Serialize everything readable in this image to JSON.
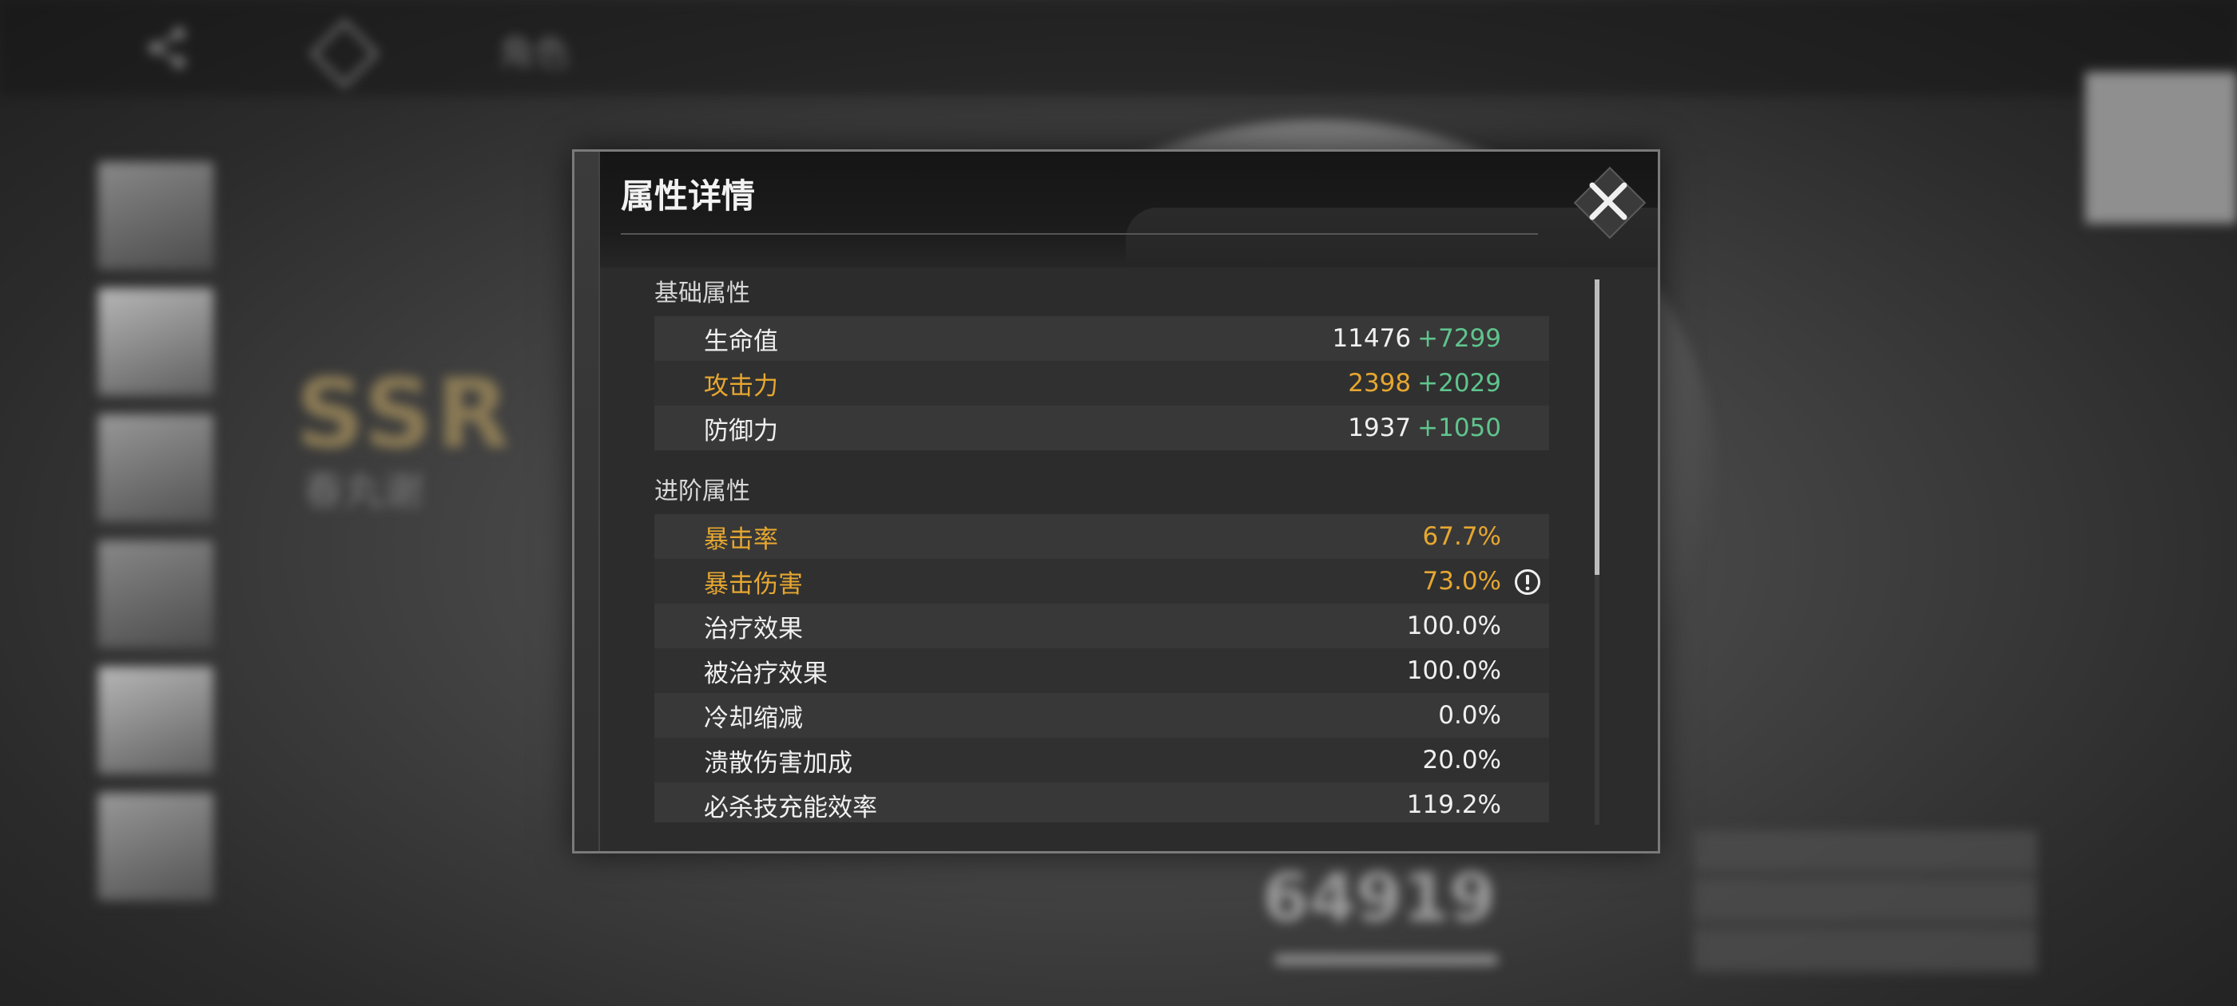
{
  "background": {
    "nav_title": "角色",
    "rarity": "SSR",
    "character_name": "春丸谢",
    "power_value": "64919",
    "share_icon": "share-icon",
    "diamond_icon": "diamond-icon"
  },
  "dialog": {
    "title": "属性详情",
    "close_icon": "close-icon",
    "sections": [
      {
        "label": "基础属性",
        "rows": [
          {
            "name": "生命值",
            "base": "11476",
            "bonus": "+7299",
            "highlight": false
          },
          {
            "name": "攻击力",
            "base": "2398",
            "bonus": "+2029",
            "highlight": true
          },
          {
            "name": "防御力",
            "base": "1937",
            "bonus": "+1050",
            "highlight": false
          }
        ]
      },
      {
        "label": "进阶属性",
        "rows": [
          {
            "name": "暴击率",
            "base": "67.7%",
            "highlight": true
          },
          {
            "name": "暴击伤害",
            "base": "73.0%",
            "highlight": true,
            "info_icon": "alert-info-icon"
          },
          {
            "name": "治疗效果",
            "base": "100.0%",
            "highlight": false
          },
          {
            "name": "被治疗效果",
            "base": "100.0%",
            "highlight": false
          },
          {
            "name": "冷却缩减",
            "base": "0.0%",
            "highlight": false
          },
          {
            "name": "溃散伤害加成",
            "base": "20.0%",
            "highlight": false
          },
          {
            "name": "必杀技充能效率",
            "base": "119.2%",
            "highlight": false
          }
        ]
      }
    ],
    "scroll_position": 0.0
  },
  "colors": {
    "highlight": "#e6a730",
    "bonus": "#5fc48d",
    "text": "#f0f0f0"
  }
}
